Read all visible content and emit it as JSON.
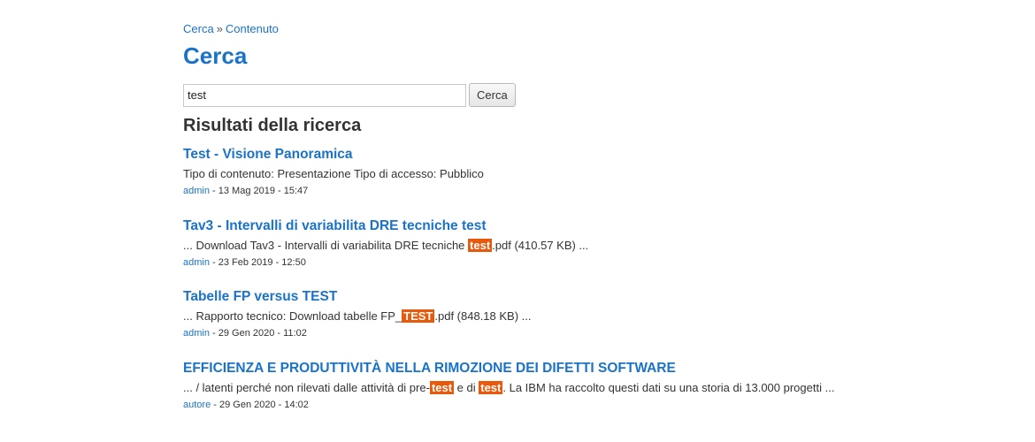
{
  "breadcrumb": {
    "items": [
      "Cerca",
      "Contenuto"
    ],
    "separator": "»"
  },
  "page_title": "Cerca",
  "search": {
    "value": "test",
    "placeholder": "",
    "button_label": "Cerca"
  },
  "results_heading": "Risultati della ricerca",
  "highlight_color": "#e8590c",
  "link_color": "#1a73c8",
  "results": [
    {
      "title": "Test - Visione Panoramica",
      "snippet": {
        "part1": "Tipo di contenuto:  Presentazione Tipo di accesso:  Pubblico"
      },
      "author": "admin",
      "date": " - 13 Mag 2019 - 15:47"
    },
    {
      "title": "Tav3 - Intervalli di variabilita DRE tecniche test",
      "snippet": {
        "part1": "... Download Tav3 - Intervalli di variabilita DRE tecniche ",
        "hl1": "test",
        "part2": ".pdf (410.57 KB) ..."
      },
      "author": "admin",
      "date": " - 23 Feb 2019 - 12:50"
    },
    {
      "title": "Tabelle FP versus TEST",
      "snippet": {
        "part1": "... Rapporto tecnico:  Download tabelle FP_",
        "hl1": "TEST",
        "part2": ".pdf (848.18 KB) ..."
      },
      "author": "admin",
      "date": " - 29 Gen 2020 - 11:02"
    },
    {
      "title": "EFFICIENZA E PRODUTTIVITÀ NELLA RIMOZIONE DEI DIFETTI SOFTWARE",
      "snippet": {
        "part1": "... / latenti perché non rilevati dalle attività di pre-",
        "hl1": "test",
        "part2": " e di ",
        "hl2": "test",
        "part3": ". La IBM ha raccolto questi dati su una storia di 13.000 progetti ..."
      },
      "author": "autore",
      "date": " - 29 Gen 2020 - 14:02"
    }
  ]
}
